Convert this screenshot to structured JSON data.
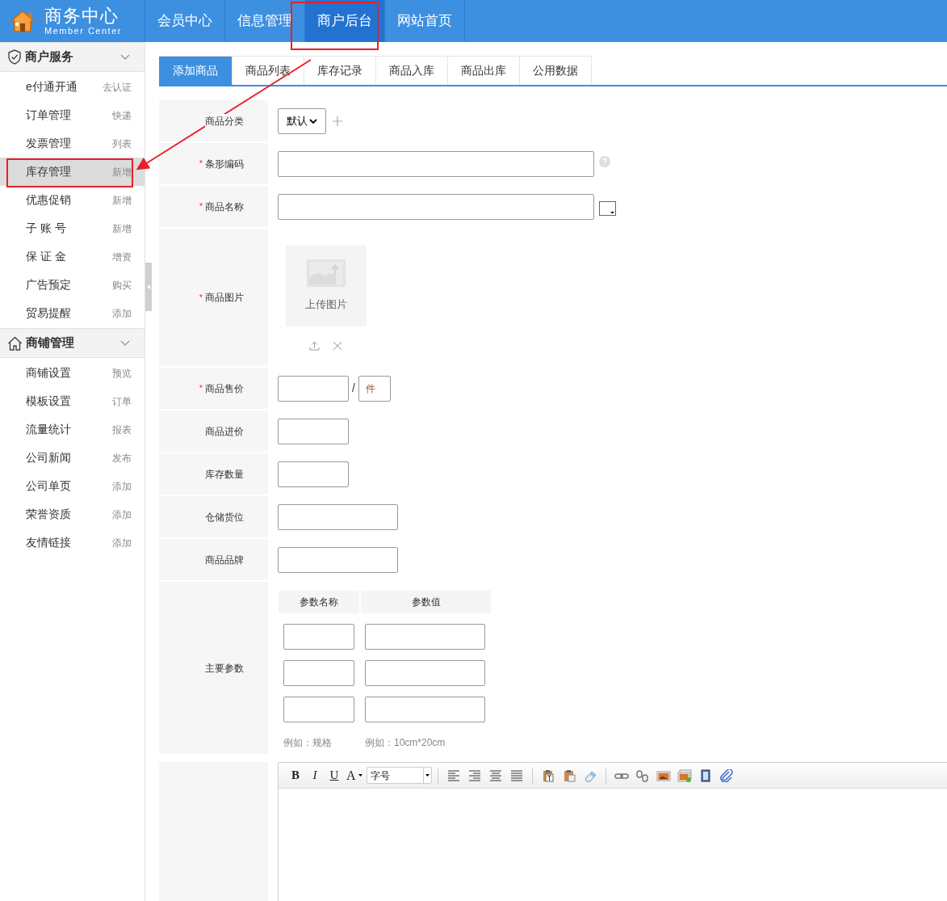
{
  "header": {
    "logo_title": "商务中心",
    "logo_subtitle": "Member Center",
    "nav": [
      {
        "label": "会员中心",
        "selected": false
      },
      {
        "label": "信息管理",
        "selected": false
      },
      {
        "label": "商户后台",
        "selected": true
      },
      {
        "label": "网站首页",
        "selected": false
      }
    ]
  },
  "sidebar": {
    "sections": [
      {
        "title": "商户服务",
        "items": [
          {
            "label": "e付通开通",
            "action": "去认证",
            "selected": false
          },
          {
            "label": "订单管理",
            "action": "快递",
            "selected": false
          },
          {
            "label": "发票管理",
            "action": "列表",
            "selected": false
          },
          {
            "label": "库存管理",
            "action": "新增",
            "selected": true
          },
          {
            "label": "优惠促销",
            "action": "新增",
            "selected": false
          },
          {
            "label": "子 账 号",
            "action": "新增",
            "selected": false
          },
          {
            "label": "保 证 金",
            "action": "增资",
            "selected": false
          },
          {
            "label": "广告预定",
            "action": "购买",
            "selected": false
          },
          {
            "label": "贸易提醒",
            "action": "添加",
            "selected": false
          }
        ]
      },
      {
        "title": "商铺管理",
        "items": [
          {
            "label": "商铺设置",
            "action": "预览",
            "selected": false
          },
          {
            "label": "模板设置",
            "action": "订单",
            "selected": false
          },
          {
            "label": "流量统计",
            "action": "报表",
            "selected": false
          },
          {
            "label": "公司新闻",
            "action": "发布",
            "selected": false
          },
          {
            "label": "公司单页",
            "action": "添加",
            "selected": false
          },
          {
            "label": "荣誉资质",
            "action": "添加",
            "selected": false
          },
          {
            "label": "友情链接",
            "action": "添加",
            "selected": false
          }
        ]
      }
    ]
  },
  "tabs": [
    {
      "label": "添加商品",
      "selected": true
    },
    {
      "label": "商品列表",
      "selected": false
    },
    {
      "label": "库存记录",
      "selected": false
    },
    {
      "label": "商品入库",
      "selected": false
    },
    {
      "label": "商品出库",
      "selected": false
    },
    {
      "label": "公用数据",
      "selected": false
    }
  ],
  "form": {
    "rows": [
      {
        "kind": "select",
        "label": "商品分类",
        "value": "默认"
      },
      {
        "kind": "barcode",
        "label": "条形编码",
        "required_mark": "*"
      },
      {
        "kind": "name",
        "label": "商品名称",
        "required_mark": "*"
      },
      {
        "kind": "image",
        "label": "商品图片",
        "required_mark": "*",
        "upload_label": "上传图片"
      },
      {
        "kind": "price",
        "label": "商品售价",
        "required_mark": "*",
        "separator": "/",
        "unit": "件"
      },
      {
        "kind": "small",
        "label": "商品进价"
      },
      {
        "kind": "small",
        "label": "库存数量"
      },
      {
        "kind": "medium",
        "label": "仓储货位"
      },
      {
        "kind": "medium",
        "label": "商品品牌"
      },
      {
        "kind": "params",
        "label": "主要参数",
        "columns": [
          "参数名称",
          "参数值"
        ],
        "hints": [
          "例如：规格",
          "例如：10cm*20cm"
        ]
      }
    ],
    "editor": {
      "bold": "B",
      "italic": "I",
      "underline": "U",
      "font_color": "A",
      "font_size": "字号"
    }
  }
}
